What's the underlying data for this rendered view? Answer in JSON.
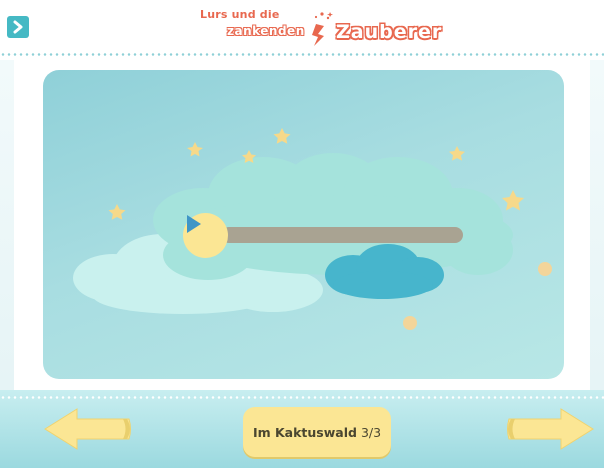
{
  "header": {
    "menu_icon": "chevron-right-icon",
    "logo": {
      "line1": "Lurs und die",
      "line2": "zankenden",
      "line3": "Zauberer"
    }
  },
  "player": {
    "play_icon": "play-icon",
    "progress": 0
  },
  "footer": {
    "prev_icon": "arrow-left-icon",
    "next_icon": "arrow-right-icon",
    "chapter_title": "Im Kaktuswald",
    "chapter_index": "3/3"
  },
  "colors": {
    "accent_teal": "#45b9c4",
    "logo_red": "#e8684f",
    "button_yellow": "#fbe694",
    "star_yellow": "#f6d98a",
    "scene_top": "#8fd0d8",
    "scene_bottom": "#b8e7e6"
  }
}
